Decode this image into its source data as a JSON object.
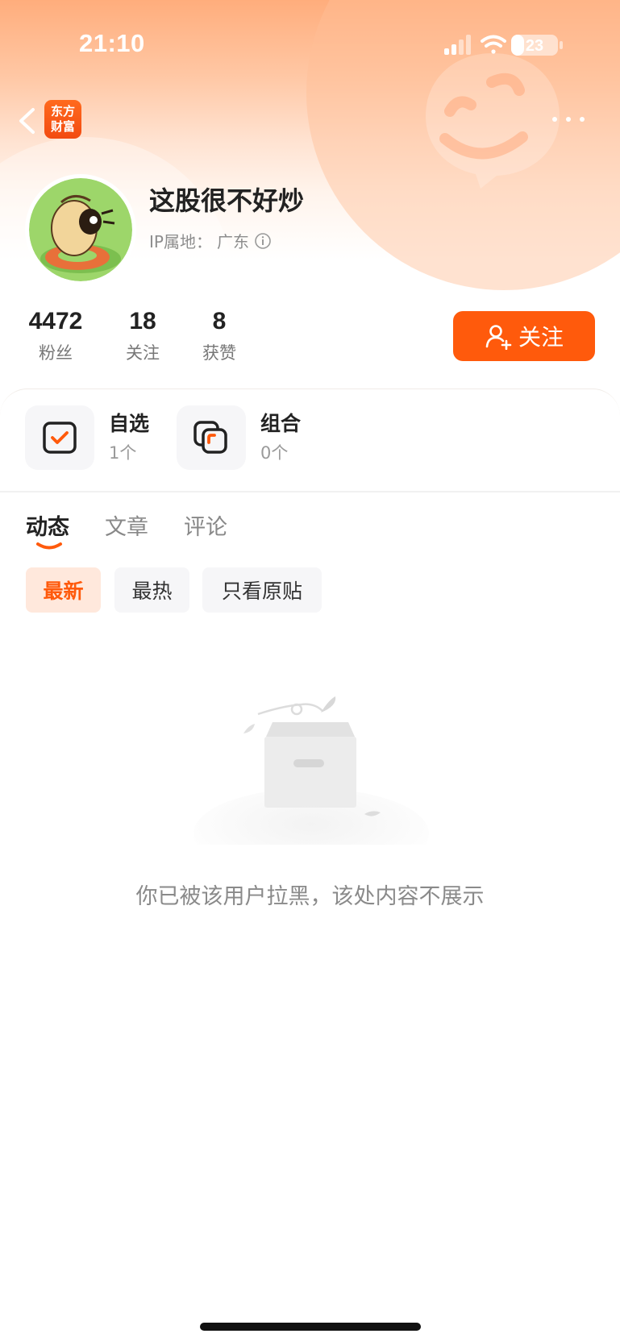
{
  "status_bar": {
    "time": "21:10",
    "battery": "23"
  },
  "nav": {
    "logo_line1": "东方",
    "logo_line2": "财富"
  },
  "profile": {
    "name": "这股很不好炒",
    "ip_label": "IP属地：",
    "ip_value": "广东"
  },
  "stats": [
    {
      "value": "4472",
      "label": "粉丝"
    },
    {
      "value": "18",
      "label": "关注"
    },
    {
      "value": "8",
      "label": "获赞"
    }
  ],
  "follow_button": {
    "label": "关注"
  },
  "entries": [
    {
      "title": "自选",
      "count": "1个"
    },
    {
      "title": "组合",
      "count": "0个"
    }
  ],
  "tabs": [
    {
      "label": "动态",
      "active": true
    },
    {
      "label": "文章",
      "active": false
    },
    {
      "label": "评论",
      "active": false
    }
  ],
  "filters": [
    {
      "label": "最新",
      "active": true
    },
    {
      "label": "最热",
      "active": false
    },
    {
      "label": "只看原贴",
      "active": false
    }
  ],
  "empty_state": {
    "message": "你已被该用户拉黑，该处内容不展示"
  },
  "colors": {
    "accent": "#ff5a0c",
    "chip_active_bg": "#ffe8dc",
    "text_primary": "#222222",
    "text_secondary": "#8a8a8a"
  }
}
